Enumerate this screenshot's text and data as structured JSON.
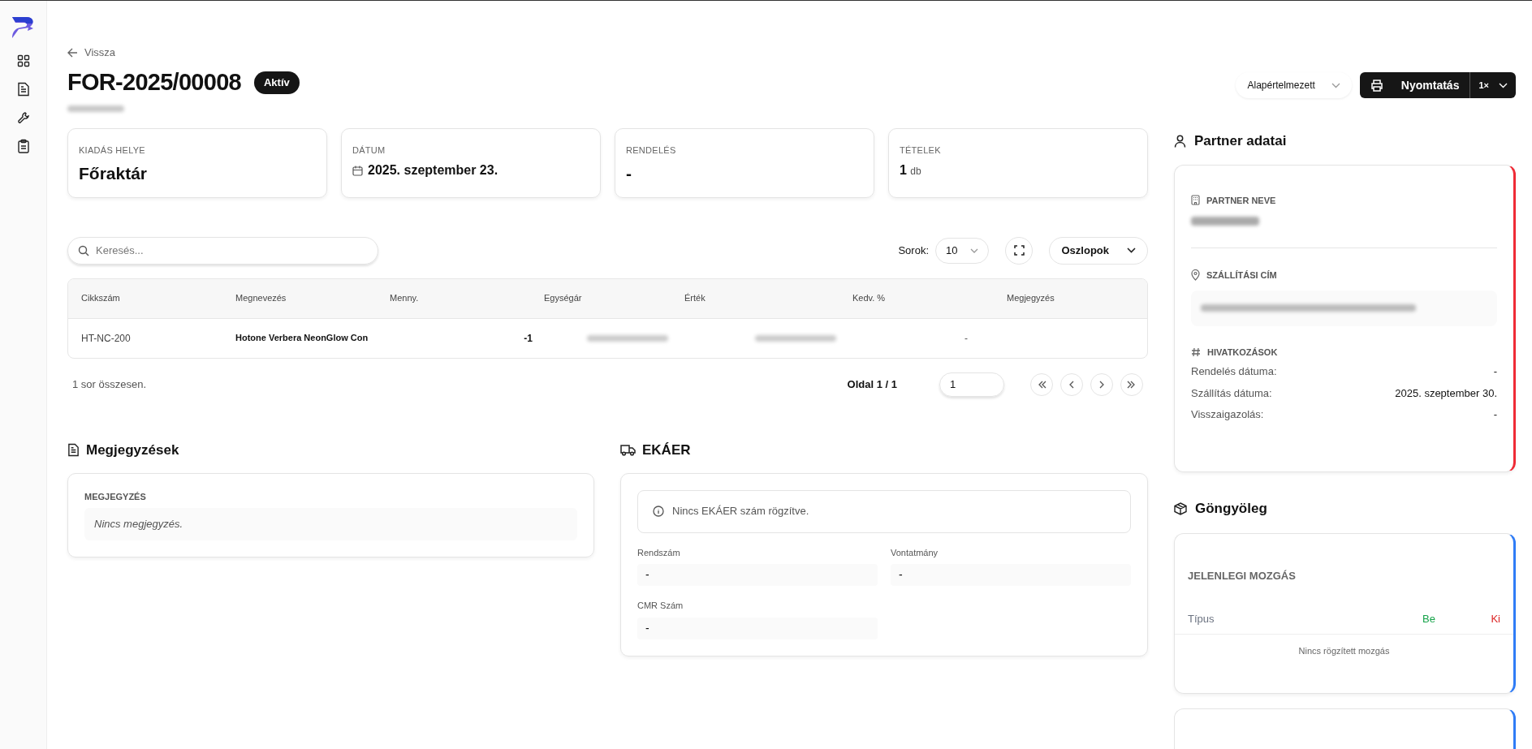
{
  "header": {
    "back_link": "Vissza",
    "title": "FOR-2025/00008",
    "status_badge": "Aktív",
    "template_select": "Alapértelmezett",
    "print_button": "Nyomtatás",
    "copies": "1×"
  },
  "summary_cards": [
    {
      "kind": "plain",
      "label": "KIADÁS HELYE",
      "value": "Főraktár"
    },
    {
      "kind": "date",
      "label": "DÁTUM",
      "value": "2025. szeptember 23."
    },
    {
      "kind": "plain",
      "label": "RENDELÉS",
      "value": "-"
    },
    {
      "kind": "count",
      "label": "TÉTELEK",
      "value": "1",
      "unit": "db"
    }
  ],
  "table": {
    "search_placeholder": "Keresés...",
    "rows_label": "Sorok:",
    "rows_per_page": "10",
    "columns_button": "Oszlopok",
    "columns": [
      "Cikkszám",
      "Megnevezés",
      "Menny.",
      "Egységár",
      "Érték",
      "Kedv. %",
      "Megjegyzés"
    ],
    "rows": [
      {
        "cells": [
          {
            "text": "HT-NC-200"
          },
          {
            "text": "Hotone Verbera NeonGlow Con"
          },
          {
            "text": "-1"
          },
          {
            "blurred": true
          },
          {
            "blurred": true
          },
          {
            "text": "-"
          },
          {
            "text": ""
          }
        ]
      }
    ],
    "total": "1 sor összesen.",
    "page_label": "Oldal 1 / 1",
    "page_input": "1"
  },
  "notes": {
    "title": "Megjegyzések",
    "label": "MEGJEGYZÉS",
    "empty": "Nincs megjegyzés."
  },
  "ekaer": {
    "title": "EKÁER",
    "info": "Nincs EKÁER szám rögzítve.",
    "fields": [
      {
        "label": "Rendszám",
        "value": "-"
      },
      {
        "label": "Vontatmány",
        "value": "-"
      },
      {
        "label": "CMR Szám",
        "value": "-"
      }
    ]
  },
  "partner": {
    "title": "Partner adatai",
    "name_label": "PARTNER NEVE",
    "address_label": "SZÁLLÍTÁSI CÍM",
    "references_label": "HIVATKOZÁSOK",
    "references": [
      {
        "label": "Rendelés dátuma:",
        "value": "-"
      },
      {
        "label": "Szállítás dátuma:",
        "value": "2025. szeptember 30."
      },
      {
        "label": "Visszaigazolás:",
        "value": "-"
      }
    ]
  },
  "packaging": {
    "title": "Göngyöleg",
    "section_label": "JELENLEGI MOZGÁS",
    "columns": [
      {
        "label": "Típus",
        "color": "#6b7280"
      },
      {
        "label": "Be",
        "color": "#16a34a"
      },
      {
        "label": "Ki",
        "color": "#dc2626"
      }
    ],
    "empty": "Nincs rögzített mozgás"
  }
}
